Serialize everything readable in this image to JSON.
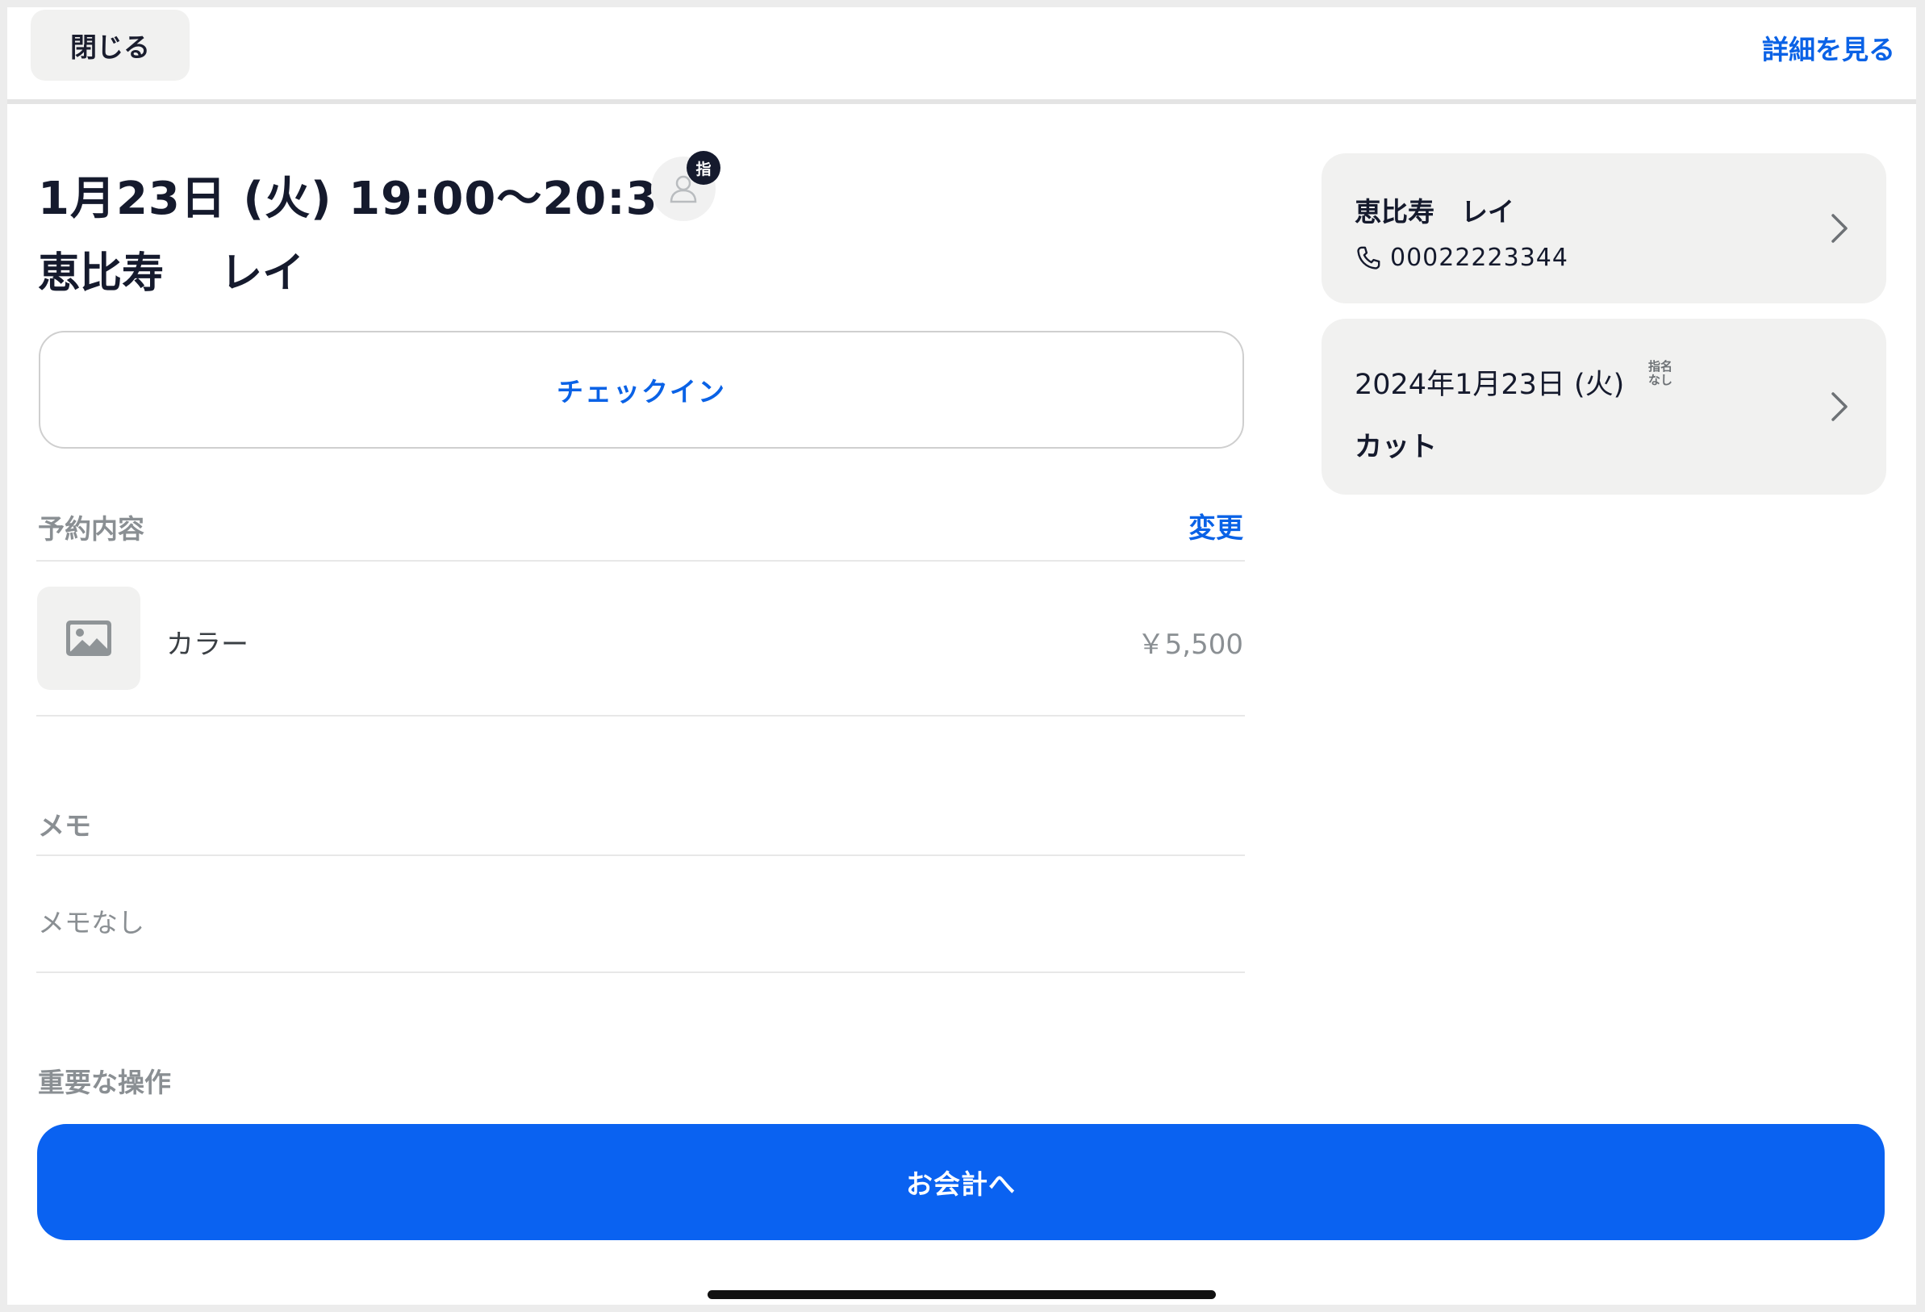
{
  "topbar": {
    "close_label": "閉じる",
    "detail_label": "詳細を見る"
  },
  "appointment": {
    "datetime": "1月23日 (火) 19:00～20:30",
    "customer_name": "恵比寿　 レイ",
    "nomination_badge": "指"
  },
  "checkin": {
    "label": "チェックイン"
  },
  "reservation": {
    "section_label": "予約内容",
    "change_label": "変更",
    "items": [
      {
        "name": "カラー",
        "price": "￥5,500"
      }
    ]
  },
  "memo": {
    "section_label": "メモ",
    "text": "メモなし"
  },
  "operations": {
    "section_label": "重要な操作",
    "checkout_label": "お会計へ"
  },
  "sidebar": {
    "customer_card": {
      "name": "恵比寿　レイ",
      "phone": "00022223344"
    },
    "visit_card": {
      "date": "2024年1月23日 (火)",
      "nomination_line1": "指名",
      "nomination_line2": "なし",
      "menu": "カット"
    }
  },
  "colors": {
    "accent": "#0a62e6",
    "primary_button": "#0a62f1",
    "card_bg": "#f1f1f0",
    "text_dark": "#151a2d",
    "text_muted": "#8a8f93"
  },
  "icons": [
    "person-icon",
    "image-placeholder-icon",
    "phone-icon",
    "chevron-right-icon"
  ]
}
